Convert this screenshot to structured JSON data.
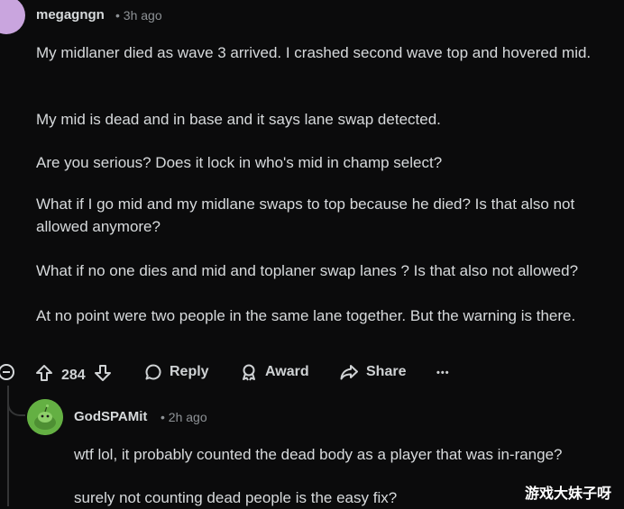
{
  "comment": {
    "author": "megagngn",
    "time": "• 3h ago",
    "paragraphs": [
      "My midlaner died as wave 3 arrived. I crashed second wave top and hovered mid.",
      "My mid is dead and in base and it says lane swap detected.",
      "Are you serious? Does it lock in who's mid in champ select?",
      "What if I go mid and my midlane swaps to top because he died? Is that also not allowed anymore?",
      "What if no one dies and mid and toplaner swap lanes ? Is that also not allowed?",
      "At no point were two people in the same lane together. But the warning is there."
    ],
    "vote_count": "284",
    "actions": {
      "reply": "Reply",
      "award": "Award",
      "share": "Share",
      "more": "•••"
    }
  },
  "reply": {
    "author": "GodSPAMit",
    "time": "• 2h ago",
    "paragraphs": [
      "wtf lol, it probably counted the dead body as a player that was in-range?",
      "surely not counting dead people is the easy fix?"
    ]
  },
  "watermark": "游戏大妹子呀",
  "icons": {
    "collapse": "collapse-icon",
    "upvote": "upvote-arrow-icon",
    "downvote": "downvote-arrow-icon",
    "reply": "speech-bubble-icon",
    "award": "award-ribbon-icon",
    "share": "share-arrow-icon",
    "more": "more-dots-icon"
  }
}
